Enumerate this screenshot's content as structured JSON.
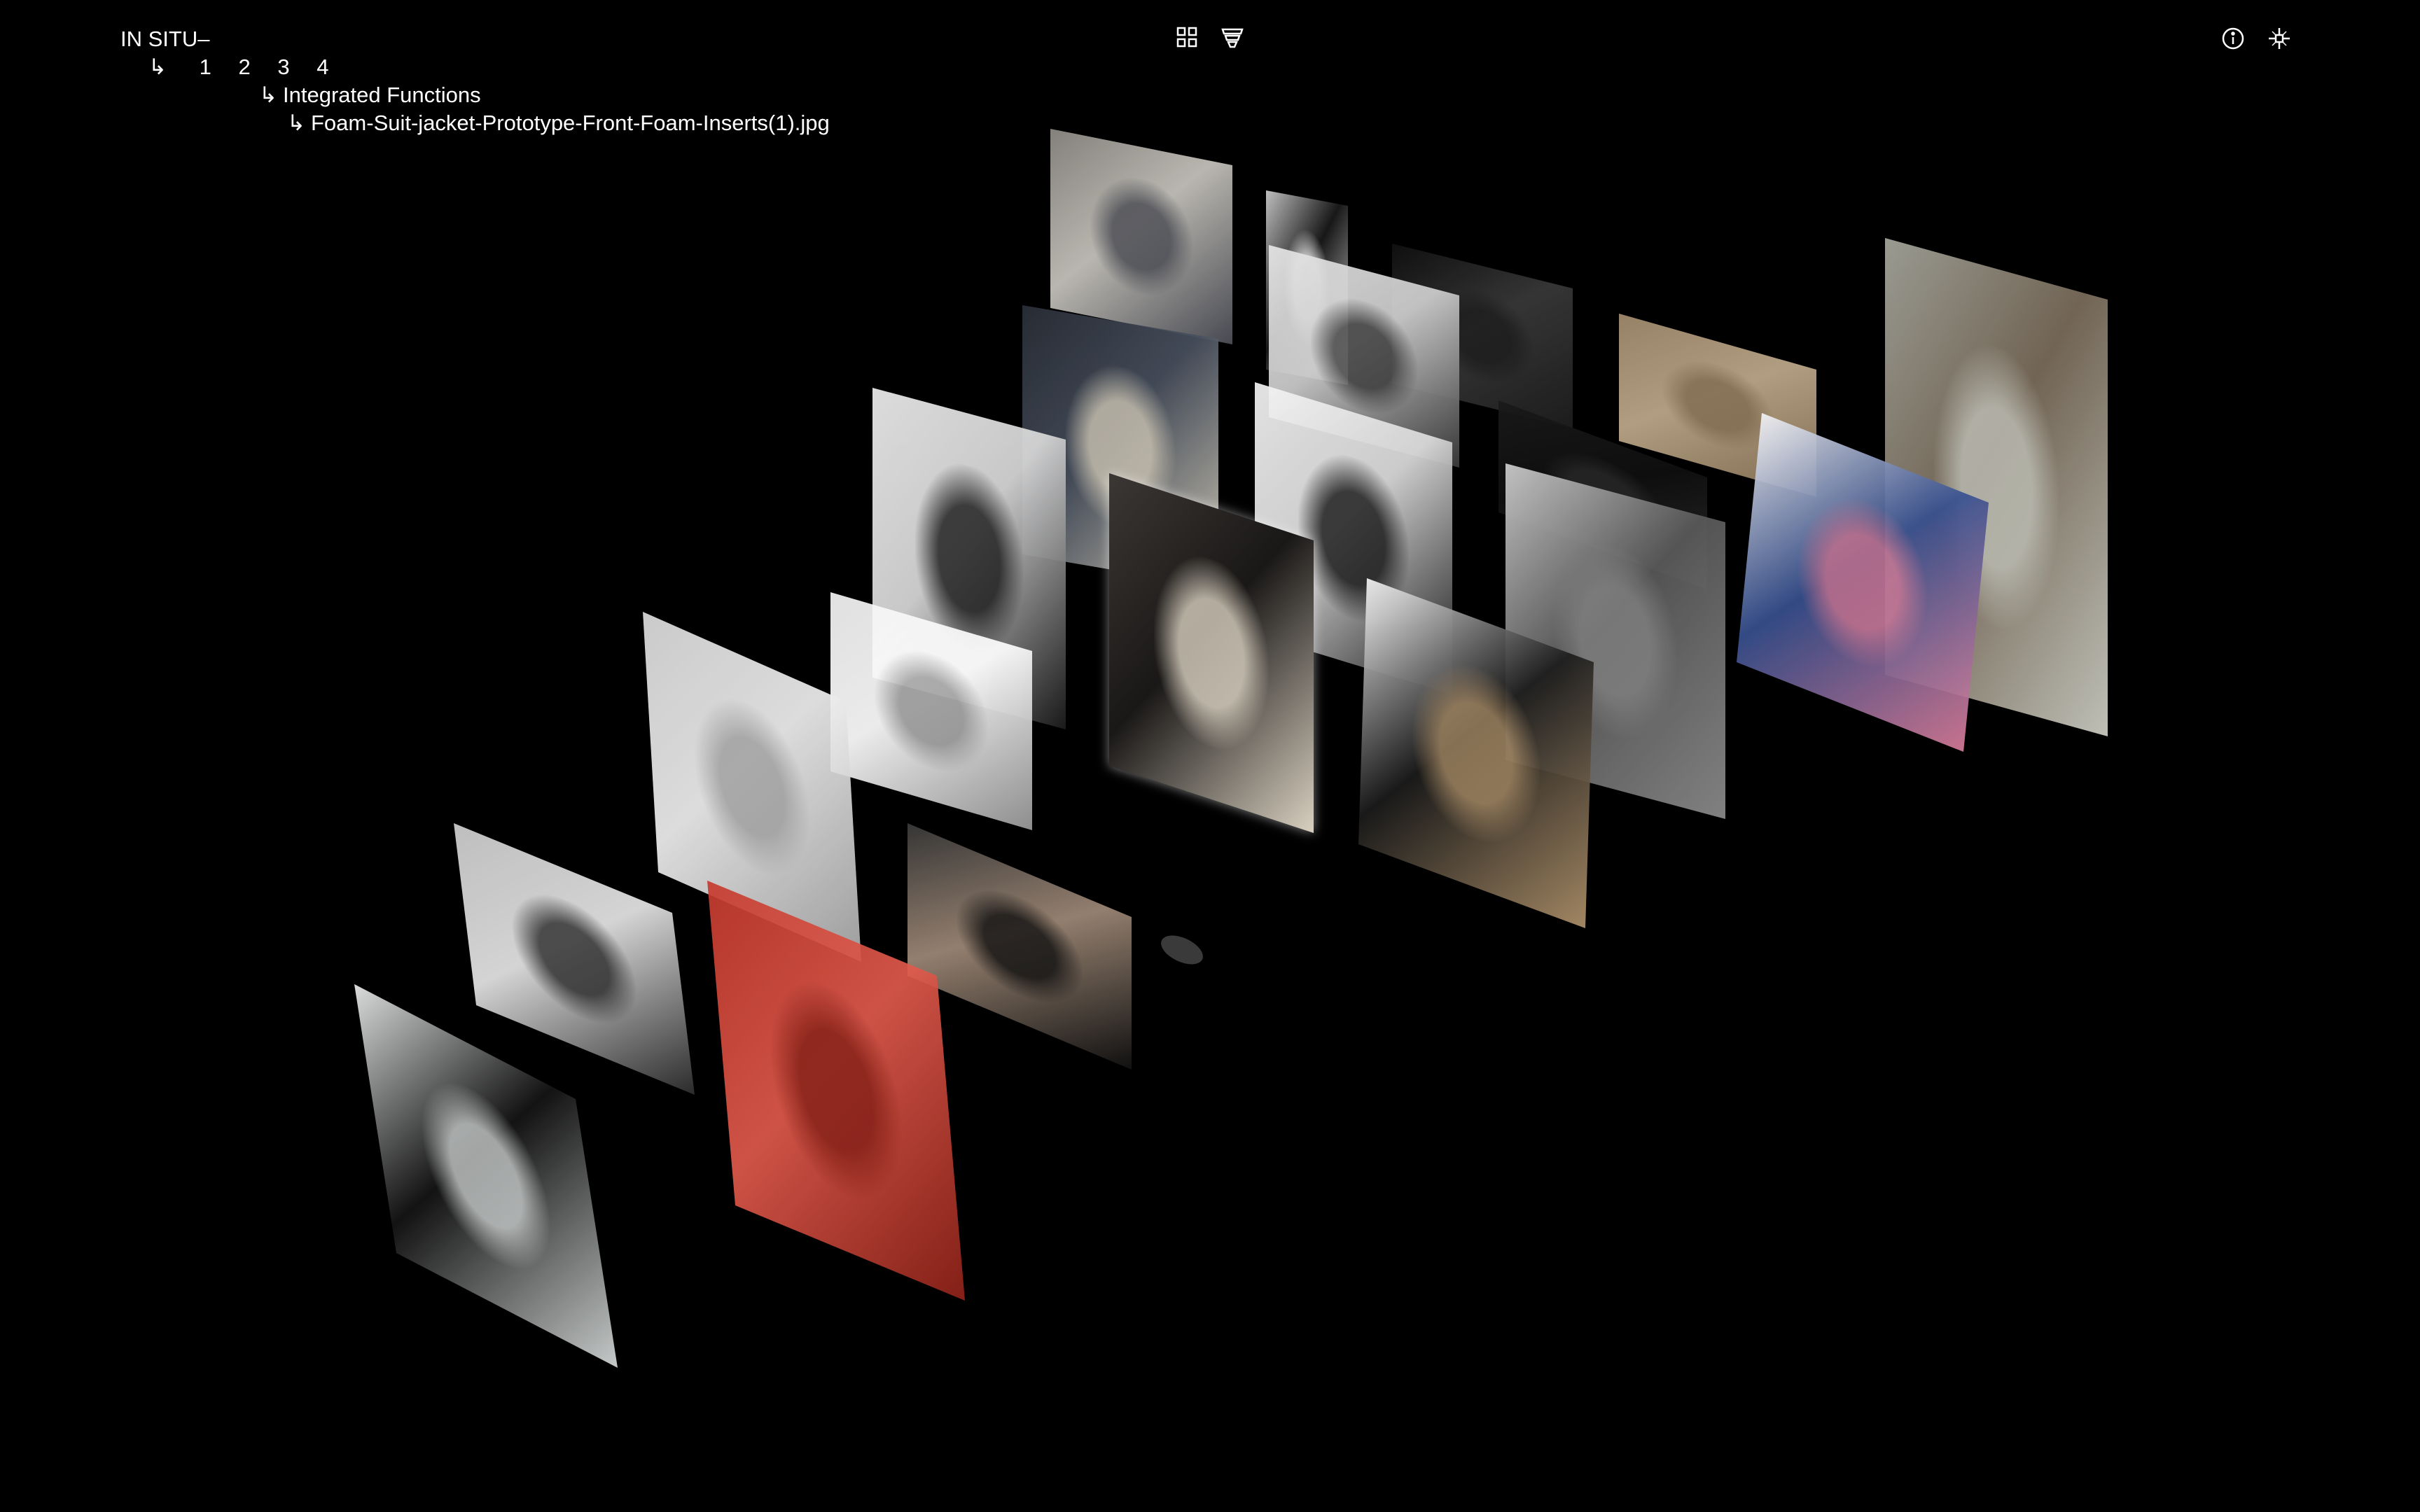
{
  "brand": "IN SITU–",
  "pages": [
    "1",
    "2",
    "3",
    "4"
  ],
  "breadcrumb": {
    "arrow": "↳",
    "section": "Integrated Functions",
    "file": "Foam-Suit-jacket-Prototype-Front-Foam-Inserts(1).jpg"
  },
  "toolbar": {
    "grid_icon": "grid-icon",
    "stack_icon": "stack-view-icon",
    "info_icon": "info-icon",
    "sparkle_icon": "sparkle-icon"
  },
  "colors": {
    "background": "#000000",
    "text": "#ffffff"
  },
  "images": [
    {
      "name": "photo-studio-workers",
      "colors": [
        "#8f8c86",
        "#4e5058",
        "#c9c6bf"
      ]
    },
    {
      "name": "photo-hanging-suit",
      "colors": [
        "#cfcfcf",
        "#f2f2f2",
        "#1a1a1a"
      ]
    },
    {
      "name": "photo-dark-shapes",
      "colors": [
        "#101010",
        "#1f1f1f",
        "#3a3a3a"
      ]
    },
    {
      "name": "photo-cardboard-box",
      "colors": [
        "#a38d6f",
        "#8a7456",
        "#c0ab8c"
      ]
    },
    {
      "name": "photo-man-with-mask",
      "colors": [
        "#a7a89e",
        "#cfd0c6",
        "#7b6d5c"
      ]
    },
    {
      "name": "photo-denim-pattern",
      "colors": [
        "#2a2f38",
        "#dcd4c1",
        "#48505e"
      ]
    },
    {
      "name": "photo-packaging",
      "colors": [
        "#e6e6e6",
        "#3b3b3b",
        "#cfcfcf"
      ]
    },
    {
      "name": "photo-dark-fabric",
      "colors": [
        "#1a1a1a",
        "#2c2c2c",
        "#101010"
      ]
    },
    {
      "name": "book-people-of-the-twenty-first-century",
      "colors": [
        "#f4f4f6",
        "#d97c99",
        "#37508f"
      ]
    },
    {
      "name": "photo-black-vest",
      "colors": [
        "#efefef",
        "#1b1b1b",
        "#dadada"
      ]
    },
    {
      "name": "photo-black-arc",
      "colors": [
        "#f5f5f5",
        "#171717",
        "#dddddd"
      ]
    },
    {
      "name": "photo-grey-gradient",
      "colors": [
        "#d0d0d0",
        "#8c8c8c",
        "#5a5a5a"
      ]
    },
    {
      "name": "photo-foam-suit-jacket-prototype",
      "colors": [
        "#3b3734",
        "#d9d0c0",
        "#1a1817"
      ]
    },
    {
      "name": "sketch-suit-drawings",
      "colors": [
        "#f4f4f4",
        "#9a9a9a",
        "#ffffff"
      ]
    },
    {
      "name": "photo-brown-paper-jacket",
      "colors": [
        "#f7f7f7",
        "#b0926b",
        "#1c1c1c"
      ]
    },
    {
      "name": "photo-white-foam-form",
      "colors": [
        "#dcdcdc",
        "#ababab",
        "#efefef"
      ]
    },
    {
      "name": "photo-models-in-suits",
      "colors": [
        "#cfcfcf",
        "#2e2e2e",
        "#e6e6e6"
      ]
    },
    {
      "name": "photo-group-in-black-suits",
      "colors": [
        "#3a3a3a",
        "#121212",
        "#a08a78"
      ]
    },
    {
      "name": "photo-red-theatre-seats",
      "colors": [
        "#c53a2e",
        "#8e2219",
        "#e05a4c"
      ]
    },
    {
      "name": "photo-model-white-shirt",
      "colors": [
        "#eef0f0",
        "#d8dbdb",
        "#151515"
      ]
    }
  ]
}
